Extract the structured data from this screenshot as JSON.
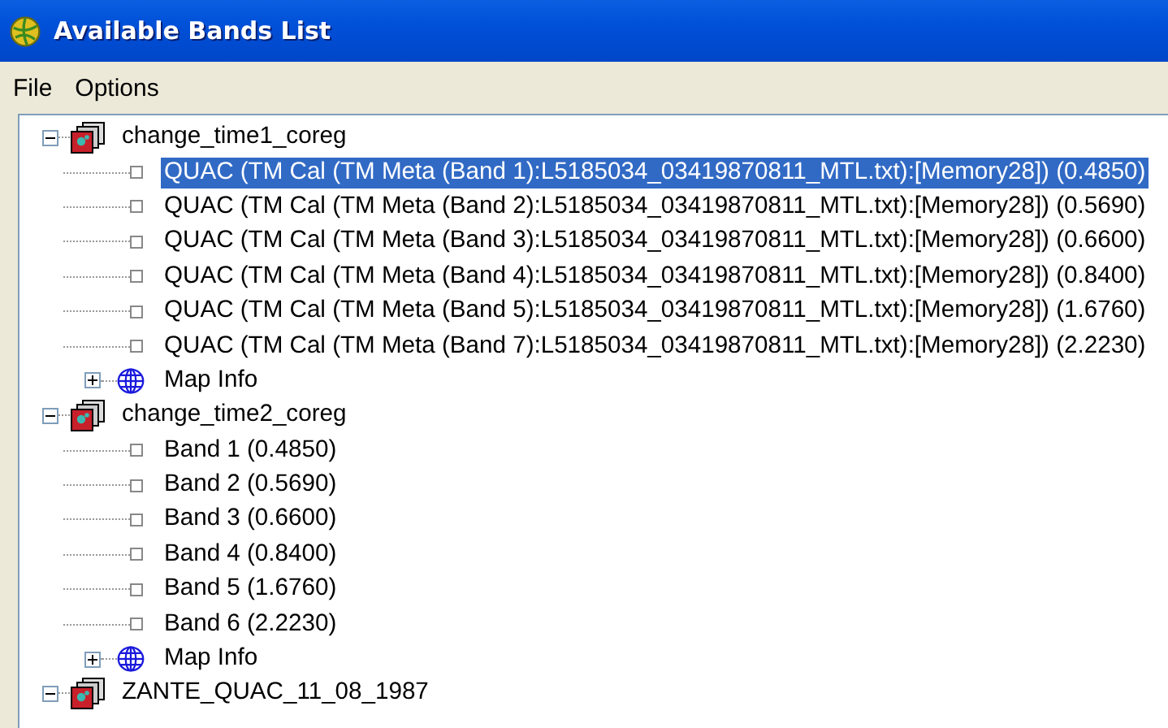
{
  "window": {
    "title": "Available Bands List"
  },
  "menu": [
    "File",
    "Options"
  ],
  "tree": [
    {
      "label": "change_time1_coreg",
      "expanded": true,
      "children": [
        {
          "kind": "band",
          "label": "QUAC (TM Cal (TM Meta (Band 1):L5185034_03419870811_MTL.txt):[Memory28]) (0.4850)",
          "selected": true
        },
        {
          "kind": "band",
          "label": "QUAC (TM Cal (TM Meta (Band 2):L5185034_03419870811_MTL.txt):[Memory28]) (0.5690)",
          "selected": false
        },
        {
          "kind": "band",
          "label": "QUAC (TM Cal (TM Meta (Band 3):L5185034_03419870811_MTL.txt):[Memory28]) (0.6600)",
          "selected": false
        },
        {
          "kind": "band",
          "label": "QUAC (TM Cal (TM Meta (Band 4):L5185034_03419870811_MTL.txt):[Memory28]) (0.8400)",
          "selected": false
        },
        {
          "kind": "band",
          "label": "QUAC (TM Cal (TM Meta (Band 5):L5185034_03419870811_MTL.txt):[Memory28]) (1.6760)",
          "selected": false
        },
        {
          "kind": "band",
          "label": "QUAC (TM Cal (TM Meta (Band 7):L5185034_03419870811_MTL.txt):[Memory28]) (2.2230)",
          "selected": false
        },
        {
          "kind": "mapinfo",
          "label": "Map Info",
          "expanded": false
        }
      ]
    },
    {
      "label": "change_time2_coreg",
      "expanded": true,
      "children": [
        {
          "kind": "band",
          "label": "Band 1 (0.4850)",
          "selected": false
        },
        {
          "kind": "band",
          "label": "Band 2 (0.5690)",
          "selected": false
        },
        {
          "kind": "band",
          "label": "Band 3 (0.6600)",
          "selected": false
        },
        {
          "kind": "band",
          "label": "Band 4 (0.8400)",
          "selected": false
        },
        {
          "kind": "band",
          "label": "Band 5 (1.6760)",
          "selected": false
        },
        {
          "kind": "band",
          "label": "Band 6 (2.2230)",
          "selected": false
        },
        {
          "kind": "mapinfo",
          "label": "Map Info",
          "expanded": false
        }
      ]
    },
    {
      "label": "ZANTE_QUAC_11_08_1987",
      "expanded": true
    }
  ]
}
